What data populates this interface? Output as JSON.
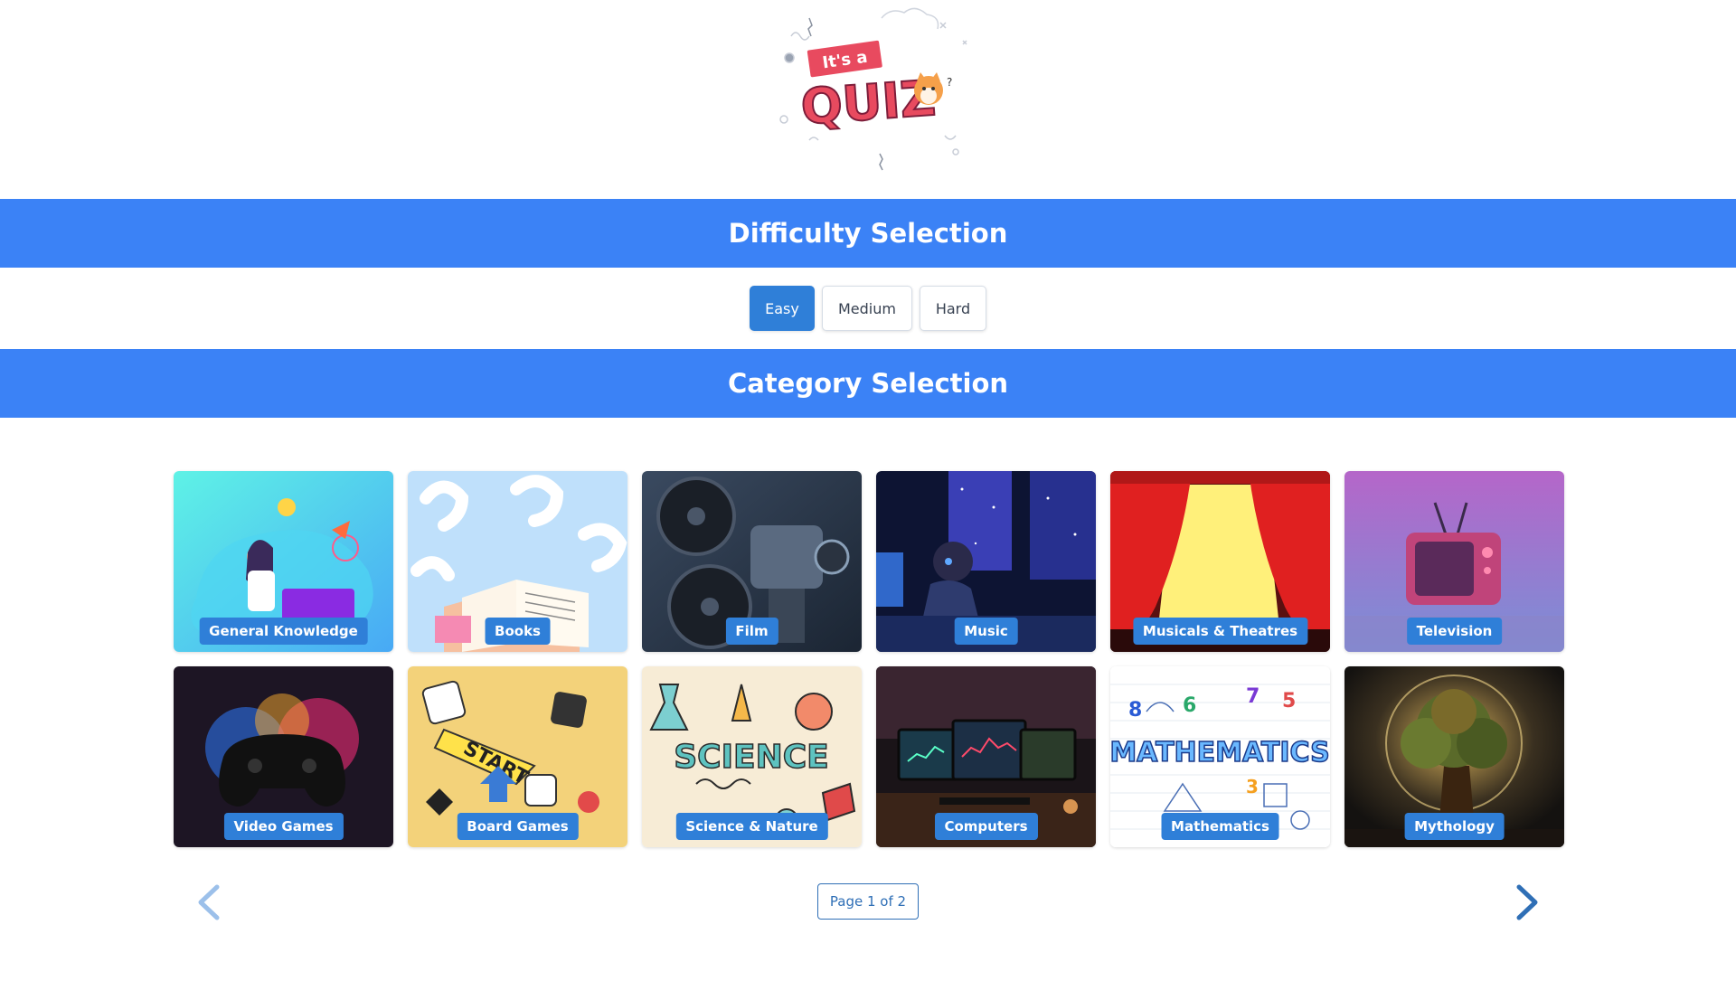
{
  "logo": {
    "line1": "It's a",
    "line2": "QUIZ"
  },
  "difficulty": {
    "title": "Difficulty Selection",
    "options": [
      "Easy",
      "Medium",
      "Hard"
    ],
    "selected": "Easy"
  },
  "category": {
    "title": "Category Selection",
    "items": [
      {
        "label": "General Knowledge",
        "icon": "scientist-illustration"
      },
      {
        "label": "Books",
        "icon": "open-book-illustration"
      },
      {
        "label": "Film",
        "icon": "film-projector-illustration"
      },
      {
        "label": "Music",
        "icon": "listening-to-music-illustration"
      },
      {
        "label": "Musicals & Theatres",
        "icon": "theatre-stage-illustration"
      },
      {
        "label": "Television",
        "icon": "retro-tv-illustration"
      },
      {
        "label": "Video Games",
        "icon": "game-controller-illustration"
      },
      {
        "label": "Board Games",
        "icon": "board-game-pieces-illustration"
      },
      {
        "label": "Science & Nature",
        "icon": "science-doodles-illustration"
      },
      {
        "label": "Computers",
        "icon": "computer-setup-illustration"
      },
      {
        "label": "Mathematics",
        "icon": "mathematics-doodles-illustration"
      },
      {
        "label": "Mythology",
        "icon": "mythic-tree-illustration"
      }
    ]
  },
  "pagination": {
    "label": "Page 1 of 2",
    "current": 1,
    "total": 2,
    "prev_icon": "chevron-left-icon",
    "next_icon": "chevron-right-icon"
  },
  "colors": {
    "banner": "#3b82f6",
    "button_selected": "#2f7fd8",
    "label_bg": "#2f7fd8",
    "logo_red": "#e84a5f"
  }
}
